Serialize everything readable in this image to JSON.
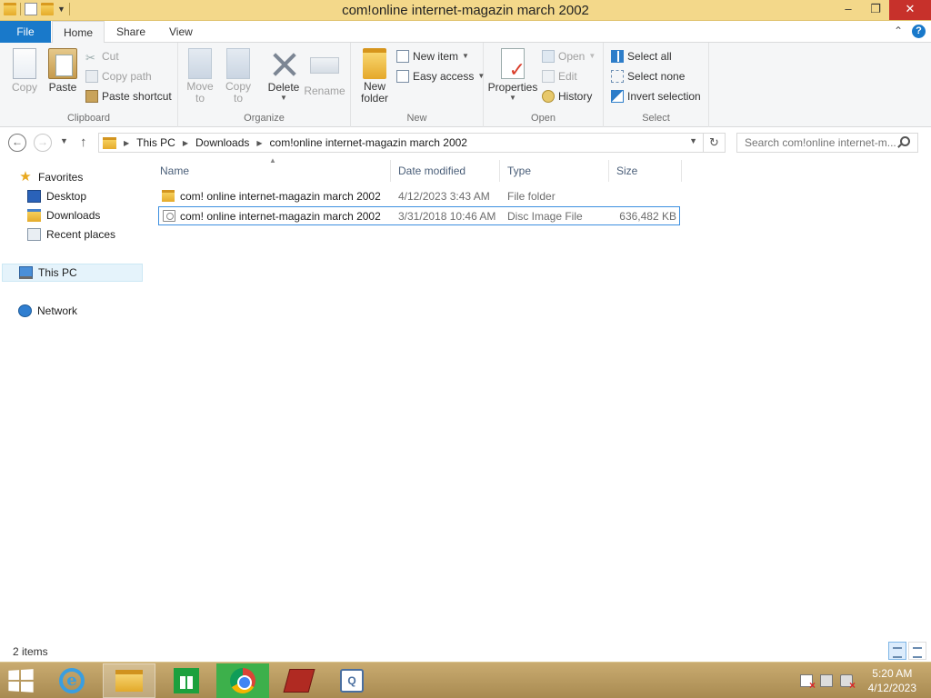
{
  "window": {
    "title": "com!online internet-magazin march 2002",
    "minimize": "–",
    "maximize": "❐",
    "close": "✕"
  },
  "ribbon_tabs": {
    "file": "File",
    "home": "Home",
    "share": "Share",
    "view": "View",
    "collapse": "⌃",
    "help": "?"
  },
  "ribbon": {
    "clipboard": {
      "label": "Clipboard",
      "copy": "Copy",
      "paste": "Paste",
      "cut": "Cut",
      "copy_path": "Copy path",
      "paste_shortcut": "Paste shortcut"
    },
    "organize": {
      "label": "Organize",
      "move_to_1": "Move",
      "move_to_2": "to",
      "copy_to_1": "Copy",
      "copy_to_2": "to",
      "delete": "Delete",
      "rename": "Rename"
    },
    "new": {
      "label": "New",
      "new_folder_1": "New",
      "new_folder_2": "folder",
      "new_item": "New item",
      "easy_access": "Easy access"
    },
    "open": {
      "label": "Open",
      "properties": "Properties",
      "open": "Open",
      "edit": "Edit",
      "history": "History"
    },
    "select": {
      "label": "Select",
      "select_all": "Select all",
      "select_none": "Select none",
      "invert_selection": "Invert selection"
    }
  },
  "address": {
    "back": "←",
    "forward": "→",
    "recent": "▼",
    "up": "↑",
    "crumbs": [
      "This PC",
      "Downloads",
      "com!online internet-magazin march 2002"
    ],
    "separator": "▶",
    "dropdown": "▼",
    "refresh": "↻",
    "search_placeholder": "Search com!online internet-m..."
  },
  "nav": {
    "favorites": "Favorites",
    "desktop": "Desktop",
    "downloads": "Downloads",
    "recent_places": "Recent places",
    "this_pc": "This PC",
    "network": "Network"
  },
  "columns": {
    "name": "Name",
    "date_modified": "Date modified",
    "type": "Type",
    "size": "Size",
    "sort_indicator": "▲"
  },
  "files": [
    {
      "name": "com! online internet-magazin march 2002",
      "date": "4/12/2023 3:43 AM",
      "type": "File folder",
      "size": "",
      "icon": "folder-icon"
    },
    {
      "name": "com! online internet-magazin march 2002",
      "date": "3/31/2018 10:46 AM",
      "type": "Disc Image File",
      "size": "636,482 KB",
      "icon": "disc-image-icon"
    }
  ],
  "status": {
    "item_count": "2 items"
  },
  "taskbar": {
    "time": "5:20 AM",
    "date": "4/12/2023",
    "ie_glyph": "e",
    "app_q_glyph": "Q"
  }
}
